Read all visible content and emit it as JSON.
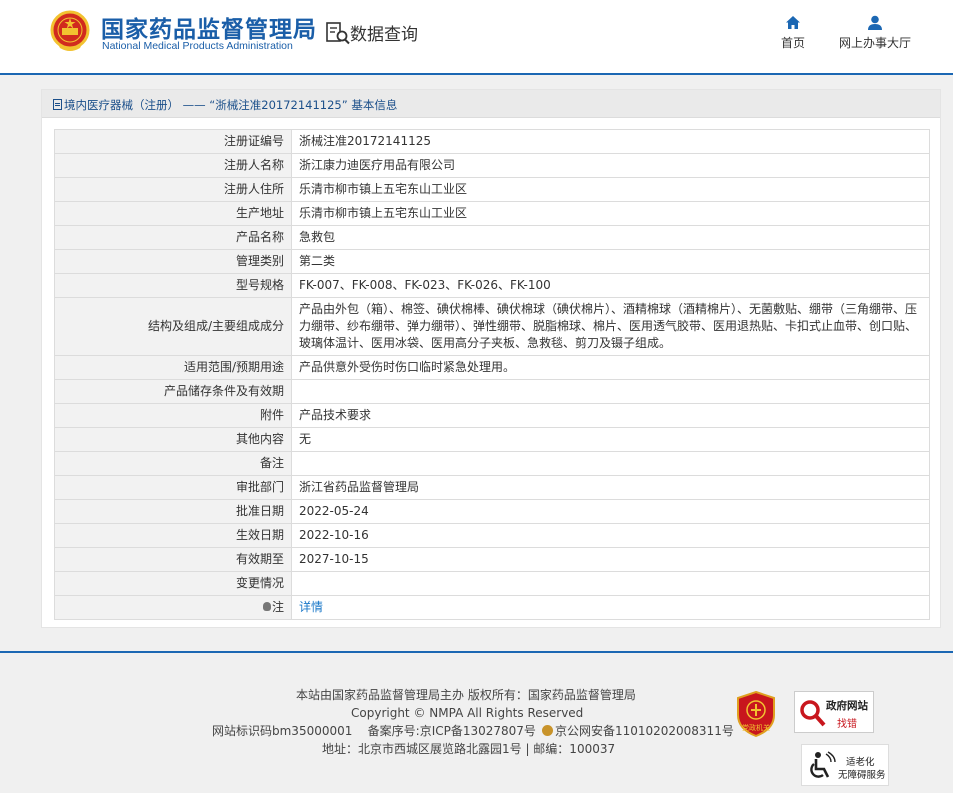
{
  "header": {
    "logo_cn": "国家药品监督管理局",
    "logo_en": "National Medical Products Administration",
    "query_label": "数据查询",
    "nav": [
      {
        "label": "首页",
        "icon": "home-icon"
      },
      {
        "label": "网上办事大厅",
        "icon": "user-icon"
      }
    ]
  },
  "breadcrumb": {
    "text": "境内医疗器械（注册） —— “浙械注准20172141125” 基本信息"
  },
  "rows": [
    {
      "key": "注册证编号",
      "value": "浙械注准20172141125"
    },
    {
      "key": "注册人名称",
      "value": "浙江康力迪医疗用品有限公司"
    },
    {
      "key": "注册人住所",
      "value": "乐清市柳市镇上五宅东山工业区"
    },
    {
      "key": "生产地址",
      "value": "乐清市柳市镇上五宅东山工业区"
    },
    {
      "key": "产品名称",
      "value": "急救包"
    },
    {
      "key": "管理类别",
      "value": "第二类"
    },
    {
      "key": "型号规格",
      "value": "FK-007、FK-008、FK-023、FK-026、FK-100"
    },
    {
      "key": "结构及组成/主要组成成分",
      "value": "产品由外包（箱）、棉签、碘伏棉棒、碘伏棉球（碘伏棉片）、酒精棉球（酒精棉片）、无菌敷贴、绷带（三角绷带、压力绷带、纱布绷带、弹力绷带）、弹性绷带、脱脂棉球、棉片、医用透气胶带、医用退热贴、卡扣式止血带、创口贴、玻璃体温计、医用冰袋、医用高分子夹板、急救毯、剪刀及镊子组成。"
    },
    {
      "key": "适用范围/预期用途",
      "value": "产品供意外受伤时伤口临时紧急处理用。"
    },
    {
      "key": "产品储存条件及有效期",
      "value": ""
    },
    {
      "key": "附件",
      "value": "产品技术要求"
    },
    {
      "key": "其他内容",
      "value": "无"
    },
    {
      "key": "备注",
      "value": ""
    },
    {
      "key": "审批部门",
      "value": "浙江省药品监督管理局"
    },
    {
      "key": "批准日期",
      "value": "2022-05-24"
    },
    {
      "key": "生效日期",
      "value": "2022-10-16"
    },
    {
      "key": "有效期至",
      "value": "2027-10-15"
    },
    {
      "key": "变更情况",
      "value": ""
    }
  ],
  "note_row": {
    "key": "注",
    "link": "详情"
  },
  "footer": {
    "line1": "本站由国家药品监督管理局主办 版权所有：国家药品监督管理局",
    "line2": "Copyright © NMPA All Rights Reserved",
    "site_id": "网站标识码bm35000001",
    "icp": "备案序号:京ICP备13027807号",
    "police": "京公网安备11010202008311号",
    "address": "地址：北京市西城区展览路北露园1号 | 邮编：100037",
    "badge_party": "党政机关",
    "badge_gov_title": "政府网站",
    "badge_gov_sub": "找错",
    "badge_acc_1": "适老化",
    "badge_acc_2": "无障碍服务"
  },
  "colors": {
    "brand_blue": "#1b67b3",
    "link_blue": "#1a78c8",
    "emblem_red": "#d12a1e",
    "emblem_gold": "#f2c230"
  }
}
